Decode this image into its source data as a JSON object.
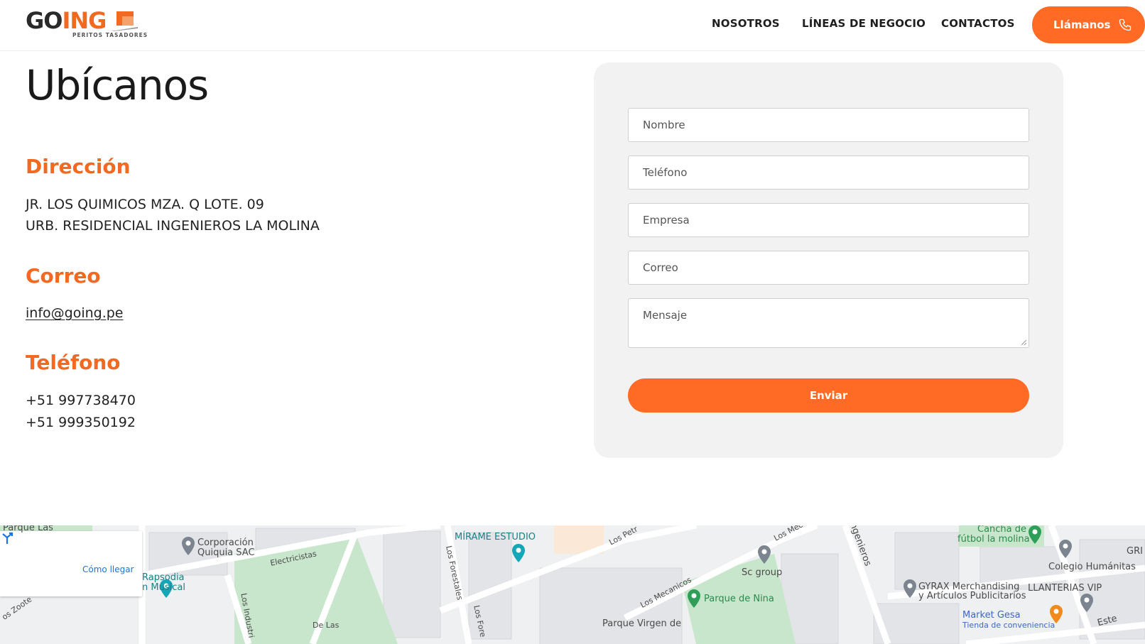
{
  "header": {
    "logo_main": "GO",
    "logo_accent": "ING",
    "logo_tagline": "PERITOS TASADORES",
    "nav": [
      "NOSOTROS",
      "LÍNEAS DE NEGOCIO",
      "CONTACTOS"
    ],
    "call_label": "Llámanos"
  },
  "contact": {
    "title": "Ubícanos",
    "address_heading": "Dirección",
    "address_line1": "JR. LOS QUIMICOS MZA. Q LOTE. 09",
    "address_line2": "URB. RESIDENCIAL INGENIEROS LA MOLINA",
    "email_heading": "Correo",
    "email": "info@going.pe",
    "phone_heading": "Teléfono",
    "phone1": "+51 997738470",
    "phone2": "+51 999350192"
  },
  "form": {
    "name_placeholder": "Nombre",
    "phone_placeholder": "Teléfono",
    "company_placeholder": "Empresa",
    "email_placeholder": "Correo",
    "message_placeholder": "Mensaje",
    "submit_label": "Enviar"
  },
  "map": {
    "directions_label": "Cómo llegar",
    "labels": {
      "parque_las": "Parque Las",
      "corporacion": "Corporación",
      "quiquia": "Quiquia SAC",
      "electricistas": "Electricistas",
      "rapsodia": "Rapsodia",
      "musical": "n Musical",
      "zoote": "os Zoote",
      "los_industr": "Los Industri",
      "mirame": "MÍRAME ESTUDIO",
      "los_forestales": "Los Forestales",
      "los_fore": "Los Fore",
      "los_petr": "Los Petr",
      "los_mec": "Los Mec",
      "los_mecanicos": "Los Mecanicos",
      "sc_group": "Sc group",
      "parque_nina": "Parque de Nina",
      "parque_virgen": "Parque Virgen de",
      "ingenieros": "Ingenieros",
      "cancha1": "Cancha de",
      "cancha2": "fútbol la molina",
      "gri": "GRI",
      "colegio": "Colegio Humánitas",
      "gyrax1": "GYRAX Merchandising",
      "gyrax2": "y Artículos Publicitarios",
      "llanterias": "LLANTERIAS VIP",
      "market": "Market Gesa",
      "tienda": "Tienda de conveniencia",
      "este": "Este",
      "de_las": "De Las"
    }
  },
  "colors": {
    "accent": "#ff6b24",
    "heading_orange": "#f26a22",
    "card_bg": "#f2f2f2"
  }
}
